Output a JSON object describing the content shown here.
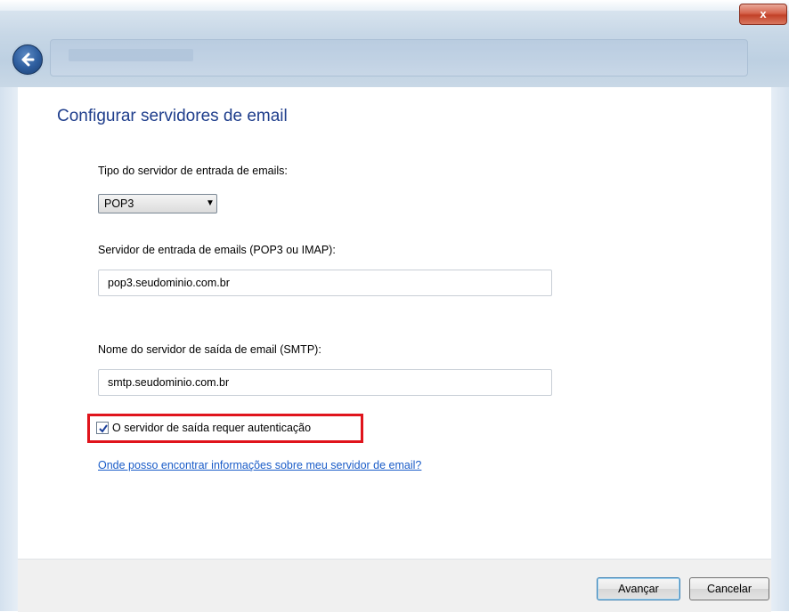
{
  "window": {
    "close_glyph": "x",
    "back_icon": "back-arrow-icon"
  },
  "page": {
    "heading": "Configurar servidores de email"
  },
  "form": {
    "incoming_type_label": "Tipo do servidor de entrada de emails:",
    "incoming_type_value": "POP3",
    "incoming_server_label": "Servidor de entrada de emails (POP3 ou IMAP):",
    "incoming_server_value": "pop3.seudominio.com.br",
    "outgoing_server_label": "Nome do servidor de saída de email (SMTP):",
    "outgoing_server_value": "smtp.seudominio.com.br",
    "auth_checkbox_label": "O servidor de saída requer autenticação",
    "auth_checkbox_checked": true,
    "help_link": "Onde posso encontrar informações sobre meu servidor de email?"
  },
  "footer": {
    "next_label": "Avançar",
    "cancel_label": "Cancelar"
  },
  "colors": {
    "heading": "#1f3e8c",
    "link": "#1a5cc8",
    "highlight": "#e0141c"
  }
}
